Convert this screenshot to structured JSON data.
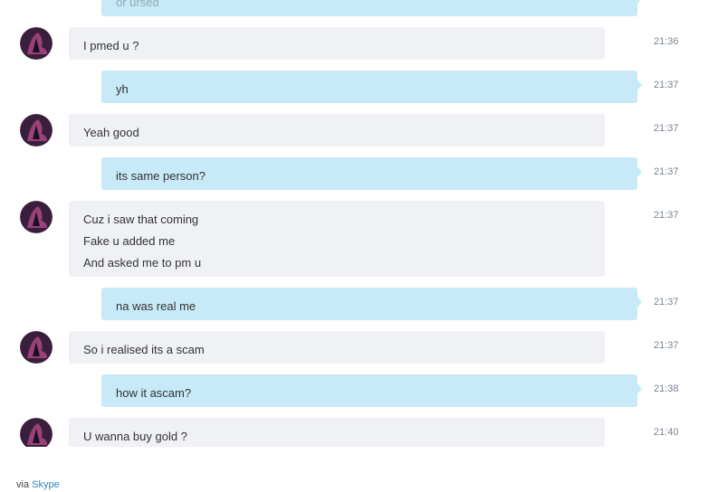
{
  "messages": [
    {
      "side": "out",
      "lines": [
        "or ursed"
      ],
      "time": ""
    },
    {
      "side": "in",
      "lines": [
        "I pmed u ?"
      ],
      "time": "21:36"
    },
    {
      "side": "out",
      "lines": [
        "yh"
      ],
      "time": "21:37"
    },
    {
      "side": "in",
      "lines": [
        "Yeah good"
      ],
      "time": "21:37"
    },
    {
      "side": "out",
      "lines": [
        "its same person?"
      ],
      "time": "21:37"
    },
    {
      "side": "in",
      "lines": [
        "Cuz i saw that coming",
        "Fake u added me",
        "And asked me to pm u"
      ],
      "time": "21:37"
    },
    {
      "side": "out",
      "lines": [
        "na was real me"
      ],
      "time": "21:37"
    },
    {
      "side": "in",
      "lines": [
        "So i realised its a scam"
      ],
      "time": "21:37"
    },
    {
      "side": "out",
      "lines": [
        "how it ascam?"
      ],
      "time": "21:38"
    },
    {
      "side": "in",
      "lines": [
        "U wanna buy gold ?"
      ],
      "time": "21:40"
    }
  ],
  "avatar": {
    "icon": "user-avatar",
    "colors": [
      "#3a1f3d",
      "#b04a8a",
      "#1a1020"
    ]
  },
  "colors": {
    "incoming_bubble": "#eff1f5",
    "outgoing_bubble": "#c7e9f8",
    "link": "#2b88c6"
  },
  "footer": {
    "prefix": "via",
    "link": "Skype"
  }
}
